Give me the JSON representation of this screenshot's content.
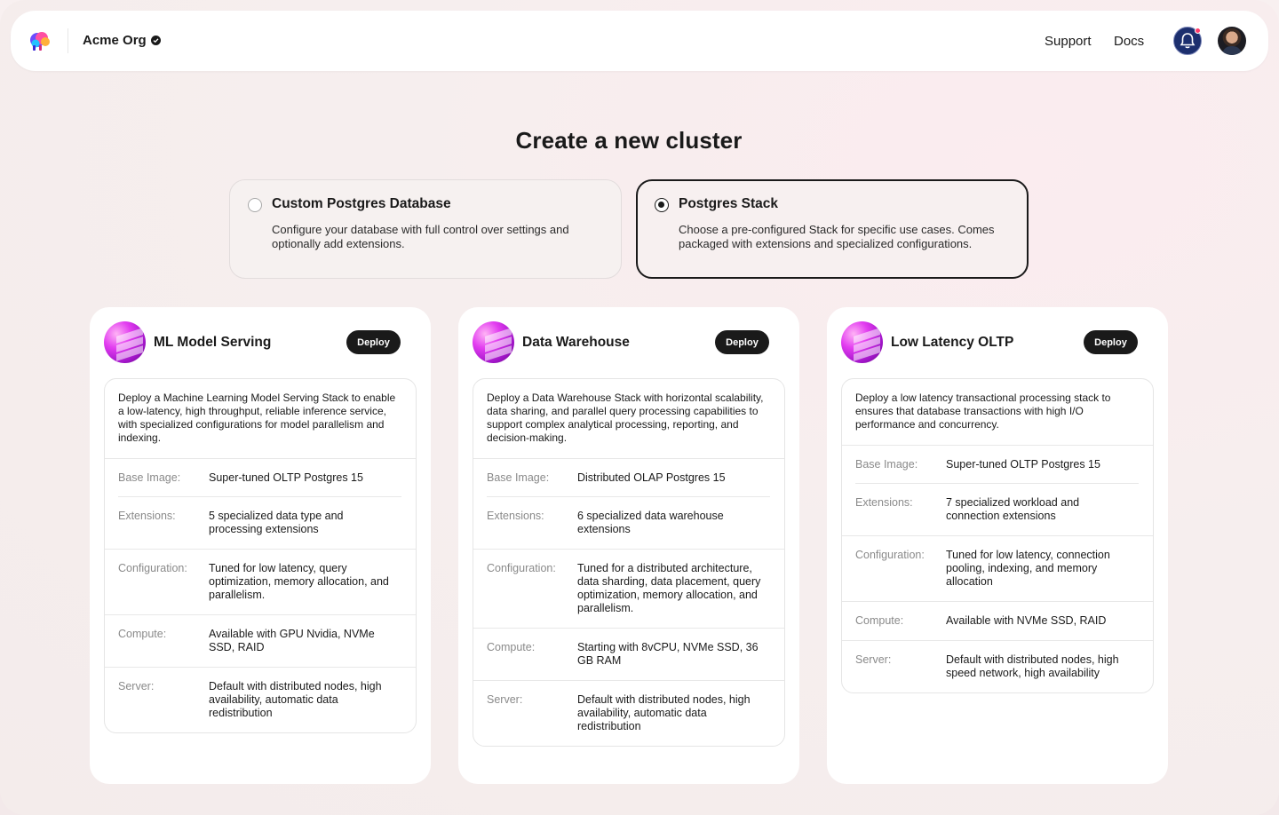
{
  "header": {
    "org_name": "Acme Org",
    "logo_icon": "elephant-logo-icon",
    "nav": {
      "support": "Support",
      "docs": "Docs"
    },
    "notification_icon": "bell-icon",
    "colors": {
      "bell_bg": "#1c2f6e",
      "notification_dot": "#ff3b6b"
    }
  },
  "page": {
    "title": "Create a new cluster"
  },
  "options": [
    {
      "title": "Custom Postgres Database",
      "description": "Configure your database with full control over settings and optionally add extensions.",
      "selected": false
    },
    {
      "title": "Postgres Stack",
      "description": "Choose a pre-configured Stack for specific use cases. Comes packaged with extensions and specialized configurations.",
      "selected": true
    }
  ],
  "stacks": [
    {
      "name": "ML Model Serving",
      "deploy_label": "Deploy",
      "description": "Deploy a Machine Learning Model Serving Stack to enable a low-latency, high throughput, reliable inference service, with specialized configurations for model parallelism and indexing.",
      "specs": [
        {
          "label": "Base Image:",
          "value": "Super-tuned OLTP Postgres 15"
        },
        {
          "label": "Extensions:",
          "value": "5 specialized data type and processing extensions"
        },
        {
          "label": "Configuration:",
          "value": "Tuned for low latency, query optimization, memory allocation, and parallelism."
        },
        {
          "label": "Compute:",
          "value": "Available with GPU Nvidia, NVMe SSD, RAID"
        },
        {
          "label": "Server:",
          "value": "Default with distributed nodes, high availability, automatic data redistribution"
        }
      ]
    },
    {
      "name": "Data Warehouse",
      "deploy_label": "Deploy",
      "description": "Deploy a Data Warehouse Stack with horizontal scalability, data sharing, and parallel query processing capabilities to support complex analytical processing, reporting, and decision-making.",
      "specs": [
        {
          "label": "Base Image:",
          "value": "Distributed OLAP Postgres 15"
        },
        {
          "label": "Extensions:",
          "value": "6 specialized data warehouse extensions"
        },
        {
          "label": "Configuration:",
          "value": "Tuned for a distributed architecture, data sharding, data placement, query optimization, memory allocation, and parallelism."
        },
        {
          "label": "Compute:",
          "value": "Starting with 8vCPU, NVMe SSD, 36 GB RAM"
        },
        {
          "label": "Server:",
          "value": "Default with distributed nodes, high availability, automatic data redistribution"
        }
      ]
    },
    {
      "name": "Low Latency OLTP",
      "deploy_label": "Deploy",
      "description": "Deploy a low latency transactional processing stack to ensures that database transactions with high I/O performance and concurrency.",
      "specs": [
        {
          "label": "Base Image:",
          "value": "Super-tuned OLTP Postgres 15"
        },
        {
          "label": "Extensions:",
          "value": "7 specialized workload and connection extensions"
        },
        {
          "label": "Configuration:",
          "value": "Tuned for low latency, connection pooling, indexing, and memory allocation"
        },
        {
          "label": "Compute:",
          "value": "Available with NVMe SSD, RAID"
        },
        {
          "label": "Server:",
          "value": "Default with distributed nodes, high speed network, high availability"
        }
      ]
    }
  ]
}
